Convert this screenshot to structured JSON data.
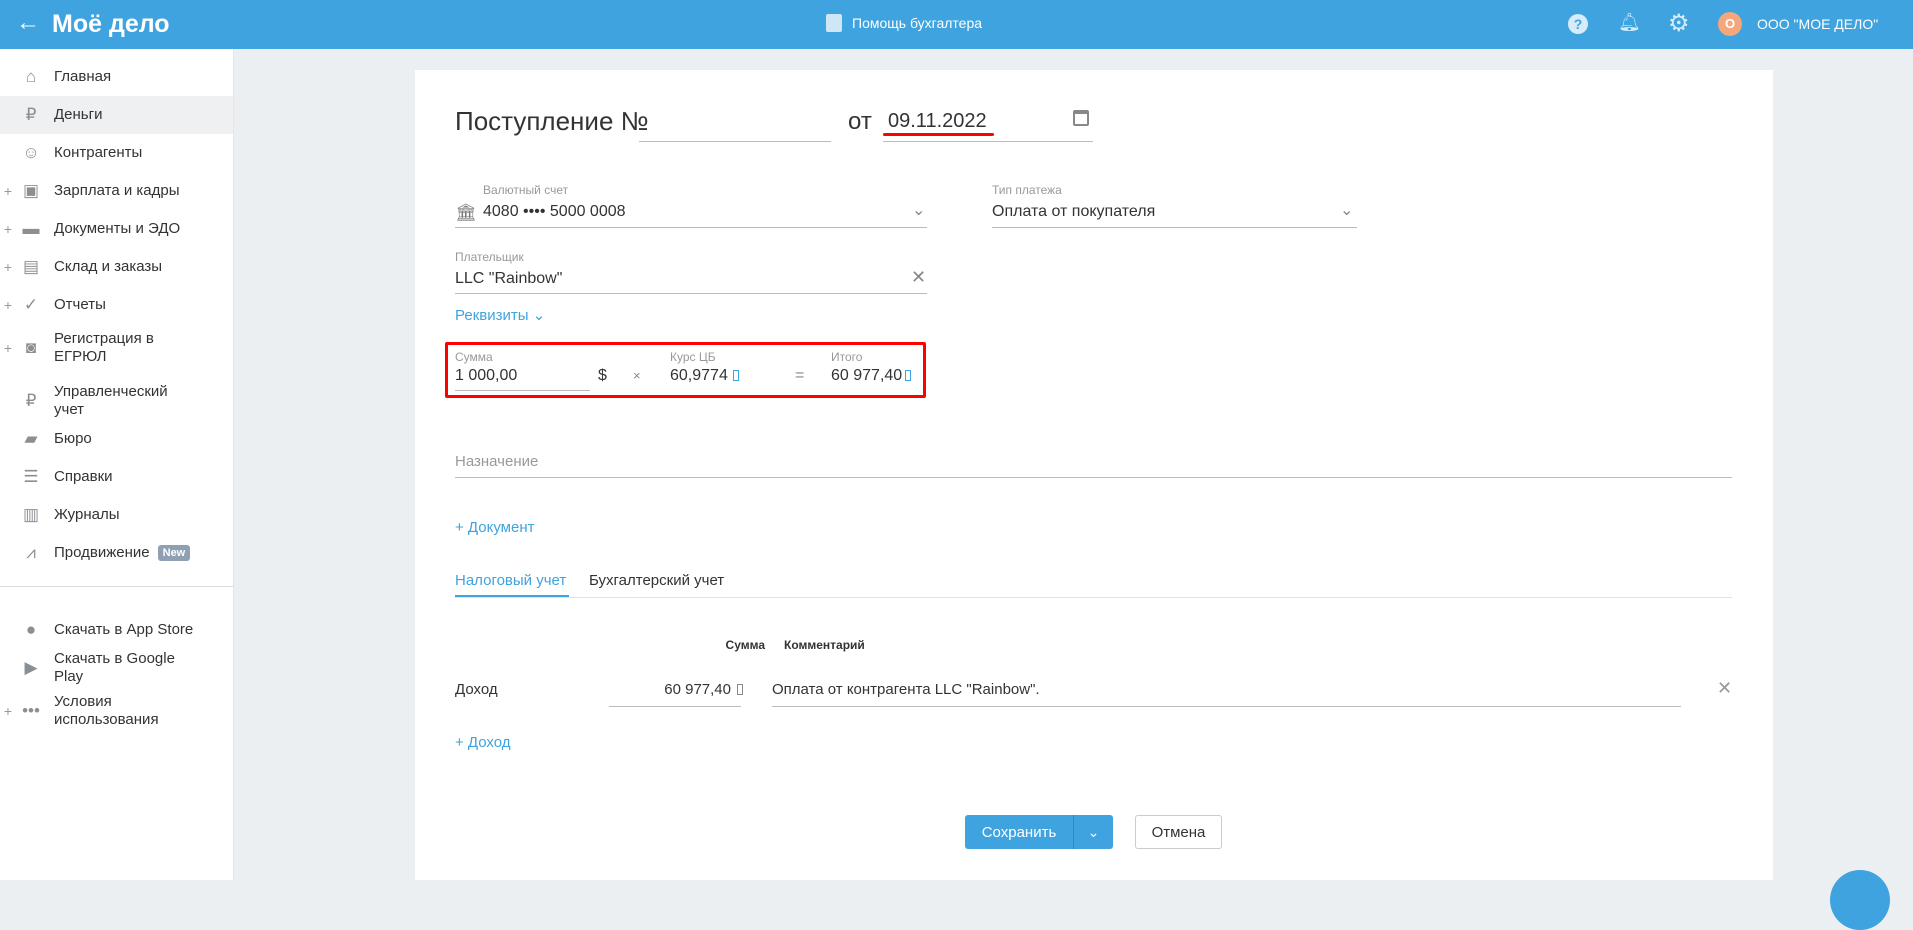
{
  "header": {
    "logo": "Моё дело",
    "help_center": "Помощь бухгалтера",
    "avatar_letter": "О",
    "company": "ООО \"МОЕ ДЕЛО\""
  },
  "sidebar": {
    "items": [
      {
        "label": "Главная",
        "icon": "home-icon",
        "plus": false
      },
      {
        "label": "Деньги",
        "icon": "money-icon",
        "plus": false,
        "active": true
      },
      {
        "label": "Контрагенты",
        "icon": "contractors-icon",
        "plus": false
      },
      {
        "label": "Зарплата и кадры",
        "icon": "wallet-icon",
        "plus": true
      },
      {
        "label": "Документы и ЭДО",
        "icon": "folder-icon",
        "plus": true
      },
      {
        "label": "Склад и заказы",
        "icon": "warehouse-icon",
        "plus": true
      },
      {
        "label": "Отчеты",
        "icon": "report-icon",
        "plus": true
      },
      {
        "label": "Регистрация в ЕГРЮЛ",
        "icon": "registration-icon",
        "plus": true
      },
      {
        "label": "Управленческий учет",
        "icon": "ruble-icon",
        "plus": false
      },
      {
        "label": "Бюро",
        "icon": "briefcase-icon",
        "plus": false
      },
      {
        "label": "Справки",
        "icon": "reference-icon",
        "plus": false
      },
      {
        "label": "Журналы",
        "icon": "journal-icon",
        "plus": false
      },
      {
        "label": "Продвижение",
        "icon": "chart-icon",
        "plus": false,
        "badge": "New"
      }
    ],
    "bottom": [
      {
        "label": "Скачать в App Store",
        "icon": "apple-icon"
      },
      {
        "label": "Скачать в Google Play",
        "icon": "google-play-icon"
      },
      {
        "label": "Условия использования",
        "icon": "more-icon"
      }
    ]
  },
  "form": {
    "title": "Поступление №",
    "number": "",
    "from": "от",
    "date": "09.11.2022",
    "account_label": "Валютный счет",
    "account_value": "4080 •••• 5000 0008",
    "payment_type_label": "Тип платежа",
    "payment_type_value": "Оплата от покупателя",
    "payer_label": "Плательщик",
    "payer_value": "LLC \"Rainbow\"",
    "details_link": "Реквизиты",
    "sum_label": "Сумма",
    "sum_value": "1 000,00",
    "currency": "$",
    "times": "×",
    "rate_label": "Курс ЦБ",
    "rate_value": "60,9774",
    "equals": "=",
    "total_label": "Итого",
    "total_value": "60 977,40",
    "purpose_placeholder": "Назначение",
    "add_document": "+ Документ",
    "tabs": [
      "Налоговый учет",
      "Бухгалтерский учет"
    ],
    "table": {
      "col_sum": "Сумма",
      "col_comment": "Комментарий",
      "row": {
        "type": "Доход",
        "amount": "60 977,40",
        "comment": "Оплата от контрагента LLC \"Rainbow\"."
      }
    },
    "add_income": "+ Доход",
    "save": "Сохранить",
    "cancel": "Отмена"
  },
  "colors": {
    "brand": "#3ea3de",
    "highlight": "#ff0000"
  }
}
